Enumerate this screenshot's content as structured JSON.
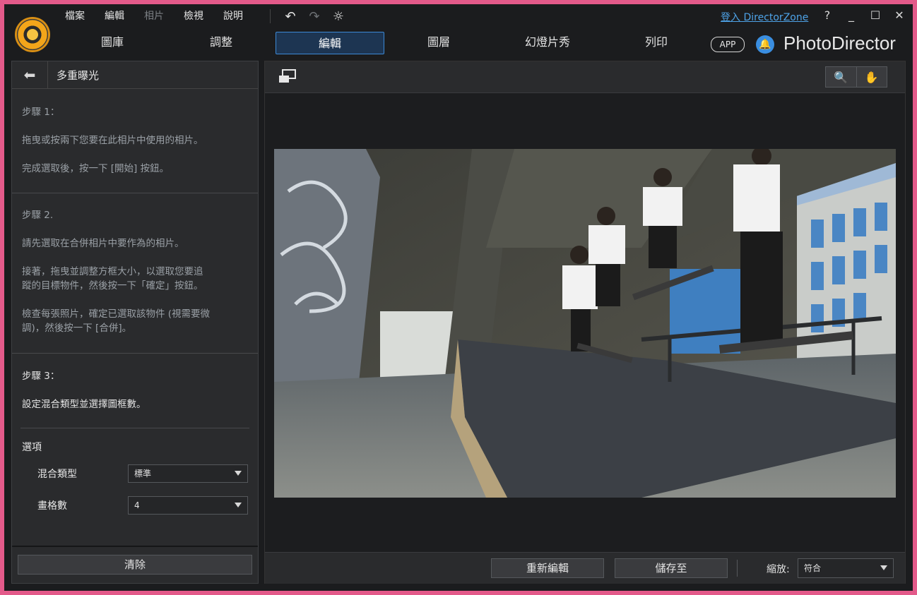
{
  "menu": [
    "檔案",
    "編輯",
    "相片",
    "檢視",
    "說明"
  ],
  "menu_dimmed_index": 2,
  "tabs": [
    "圖庫",
    "調整",
    "編輯",
    "圖層",
    "幻燈片秀",
    "列印"
  ],
  "active_tab_index": 2,
  "sign_in_label": "登入 DirectorZone",
  "help_label": "?",
  "app_badge": "APP",
  "brand": "PhotoDirector",
  "left_panel": {
    "title": "多重曝光",
    "step1_title": "步驟 1：",
    "step1_text1": "拖曳或按兩下您要在此相片中使用的相片。",
    "step1_text2": "完成選取後，按一下 [開始] 按鈕。",
    "step2_title": "步驟 2.",
    "step2_text1": "請先選取在合併相片中要作為的相片。",
    "step2_text2a": "接著，拖曳並調整方框大小，以選取您要追",
    "step2_text2b": "蹤的目標物件，然後按一下「確定」按鈕。",
    "step2_text3a": "檢查每張照片，確定已選取該物件 (視需要微",
    "step2_text3b": "調)，然後按一下 [合併]。",
    "step3_title": "步驟 3：",
    "step3_text": "設定混合類型並選擇圖框數。",
    "options_title": "選項",
    "blend_label": "混合類型",
    "blend_value": "標準",
    "frames_label": "畫格數",
    "frames_value": "4",
    "clear_button": "清除"
  },
  "viewer": {
    "reedit_button": "重新編輯",
    "save_button": "儲存至",
    "zoom_label": "縮放:",
    "zoom_value": "符合"
  },
  "colors": {
    "frame_border": "#e35a8a",
    "accent": "#3c89d6",
    "link": "#4ea3e8"
  }
}
